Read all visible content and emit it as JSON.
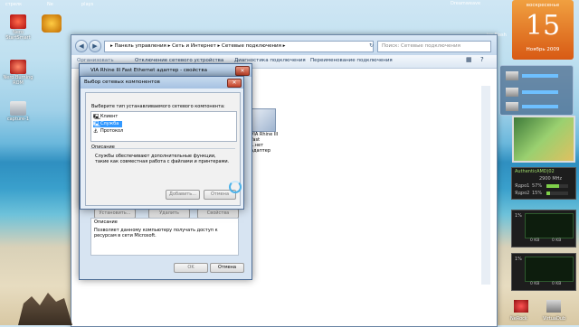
{
  "desktop_icons": [
    {
      "label": "Nero StartSmart"
    },
    {
      "label": "Nero Burning ROM"
    },
    {
      "label": "capture-1"
    }
  ],
  "desktop_top_labels": [
    "стрелк",
    "Ne",
    "plays"
  ],
  "right_top_labels": [
    "Dreamweave",
    "ise Flash"
  ],
  "explorer": {
    "address": "▸ Панель управления ▸ Сеть и Интернет ▸ Сетевые подключения ▸",
    "search_placeholder": "Поиск: Сетевые подключения",
    "cmd_truncated_left": "Организовать",
    "cmd_items": [
      "Отключение сетевого устройства",
      "Диагностика подключения",
      "Переименование подключения"
    ],
    "adapter_name": "VIA Rhine III Fast",
    "adapter_sub": "...нет адаптер"
  },
  "properties": {
    "title": "VIA Rhine III Fast Ethernet адаптер - свойства",
    "close": "✕",
    "buttons": {
      "install": "Установить...",
      "uninstall": "Удалить",
      "props": "Свойства"
    },
    "desc_label": "Описание",
    "desc_text": "Позволяет данному компьютеру получать доступ к ресурсам в сети Microsoft.",
    "ok": "OK",
    "cancel": "Отмена"
  },
  "select_dialog": {
    "title": "Выбор сетевых компонентов",
    "close": "✕",
    "prompt": "Выберите тип устанавливаемого сетевого компонента:",
    "items": [
      {
        "label": "Клиент",
        "glyph": "🖳"
      },
      {
        "label": "Служба",
        "glyph": "🖳",
        "selected": true
      },
      {
        "label": "Протокол",
        "glyph": "⚓"
      }
    ],
    "desc_label": "Описание",
    "desc_text": "Службы обеспечивают дополнительные функции, такие как совместная работа с файлами и принтерами.",
    "add": "Добавить...",
    "cancel": "Отмена"
  },
  "calendar": {
    "weekday": "воскресенье",
    "day": "15",
    "month_year": "Ноябрь 2009"
  },
  "cpu_gadget": {
    "name": "AuthenticAMD|02",
    "mhz": "2900 MHz",
    "core1": "Ядро1",
    "core1_pct": "57%",
    "core2": "Ядро2",
    "core2_pct": "15%"
  },
  "net_gadgets": [
    {
      "pct": "1%",
      "kb": "0 KB",
      "kb2": "0 KB"
    },
    {
      "pct": "1%",
      "kb": "0 KB",
      "kb2": "0 KB"
    }
  ],
  "bottom_right_labels": [
    "NeRock",
    "VirtuaDub"
  ],
  "colors": {
    "accent": "#2f6fb0",
    "calendar": "#e07020",
    "selection": "#3399ff"
  }
}
